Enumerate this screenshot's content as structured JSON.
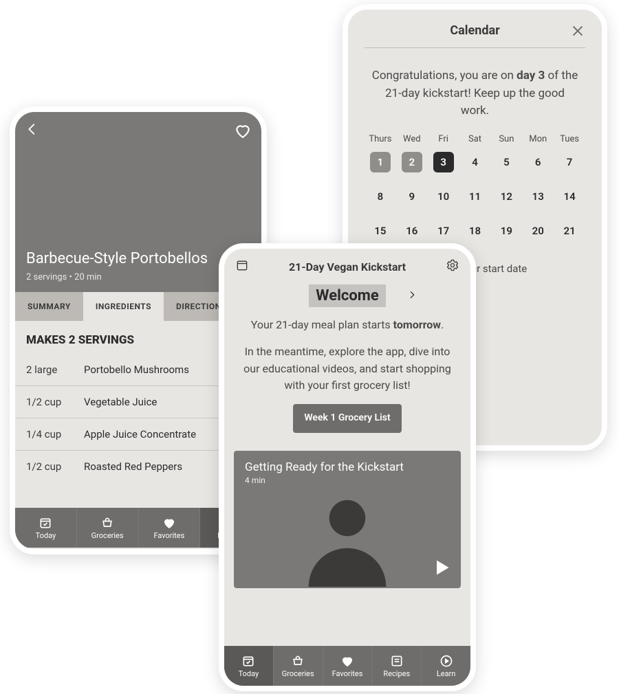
{
  "recipe": {
    "title": "Barbecue-Style Portobellos",
    "subtitle": "2 servings  •  20 min",
    "tabs": {
      "summary": "SUMMARY",
      "ingredients": "INGREDIENTS",
      "directions": "DIRECTIONS"
    },
    "makes": "MAKES 2 SERVINGS",
    "ingredients": [
      {
        "qty": "2 large",
        "name": "Portobello Mushrooms"
      },
      {
        "qty": "1/2 cup",
        "name": "Vegetable Juice"
      },
      {
        "qty": "1/4 cup",
        "name": "Apple Juice Concentrate"
      },
      {
        "qty": "1/2 cup",
        "name": "Roasted Red Peppers"
      }
    ],
    "nav": {
      "today": "Today",
      "groceries": "Groceries",
      "favorites": "Favorites",
      "recipes": "Recipes"
    }
  },
  "welcome": {
    "app_title": "21-Day Vegan Kickstart",
    "headline": "Welcome",
    "line1_a": "Your 21-day meal plan starts ",
    "line1_b": "tomorrow",
    "line1_c": ".",
    "line2": "In the meantime, explore the app, dive into our educational videos, and start shopping with your first grocery list!",
    "button": "Week 1 Grocery List",
    "video_title": "Getting Ready for the Kickstart",
    "video_meta": "4 min",
    "nav": {
      "today": "Today",
      "groceries": "Groceries",
      "favorites": "Favorites",
      "recipes": "Recipes",
      "learn": "Learn"
    }
  },
  "calendar": {
    "title": "Calendar",
    "congrats_a": "Congratulations, you are on ",
    "congrats_b": "day 3",
    "congrats_c": " of the 21-day kickstart! Keep up the good work.",
    "dow": [
      "Thurs",
      "Wed",
      "Fri",
      "Sat",
      "Sun",
      "Mon",
      "Tues"
    ],
    "days": [
      "1",
      "2",
      "3",
      "4",
      "5",
      "6",
      "7",
      "8",
      "9",
      "10",
      "11",
      "12",
      "13",
      "14",
      "15",
      "16",
      "17",
      "18",
      "19",
      "20",
      "21"
    ],
    "today_index": 2,
    "start_date_line": "Change your start date"
  }
}
